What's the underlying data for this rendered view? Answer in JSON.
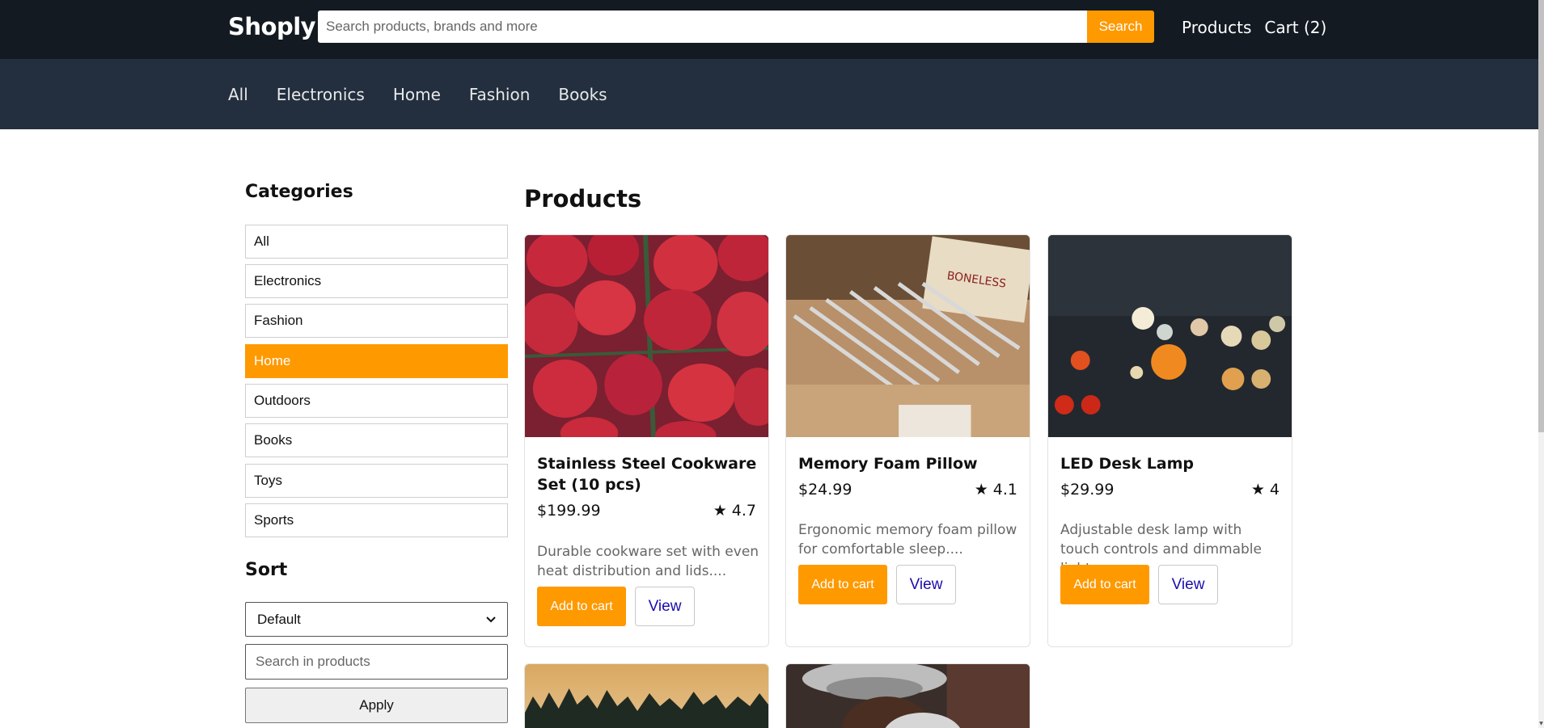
{
  "header": {
    "logo": "Shoply",
    "search_placeholder": "Search products, brands and more",
    "search_button": "Search",
    "links": [
      "Products",
      "Cart (2)"
    ]
  },
  "nav": {
    "links": [
      "All",
      "Electronics",
      "Home",
      "Fashion",
      "Books"
    ]
  },
  "sidebar": {
    "categories_title": "Categories",
    "categories": [
      {
        "label": "All",
        "active": false
      },
      {
        "label": "Electronics",
        "active": false
      },
      {
        "label": "Fashion",
        "active": false
      },
      {
        "label": "Home",
        "active": true
      },
      {
        "label": "Outdoors",
        "active": false
      },
      {
        "label": "Books",
        "active": false
      },
      {
        "label": "Toys",
        "active": false
      },
      {
        "label": "Sports",
        "active": false
      }
    ],
    "sort_title": "Sort",
    "sort_selected": "Default",
    "search_placeholder": "Search in products",
    "apply_label": "Apply"
  },
  "main": {
    "title": "Products",
    "products": [
      {
        "name": "Stainless Steel Cookware Set (10 pcs)",
        "price": "$199.99",
        "rating": "★ 4.7",
        "description": "Durable cookware set with even heat distribution and lids....",
        "add_label": "Add to cart",
        "view_label": "View",
        "image": "strawberries-photo"
      },
      {
        "name": "Memory Foam Pillow",
        "price": "$24.99",
        "rating": "★ 4.1",
        "description": "Ergonomic memory foam pillow for comfortable sleep....",
        "add_label": "Add to cart",
        "view_label": "View",
        "image": "rulers-photo"
      },
      {
        "name": "LED Desk Lamp",
        "price": "$29.99",
        "rating": "★ 4",
        "description": "Adjustable desk lamp with touch controls and dimmable light....",
        "add_label": "Add to cart",
        "view_label": "View",
        "image": "bokeh-lights-photo"
      },
      {
        "name": "",
        "image": "forest-sunset-photo"
      },
      {
        "name": "",
        "image": "person-hat-photo"
      }
    ]
  },
  "colors": {
    "header_bg": "#131a22",
    "nav_bg": "#232f3e",
    "accent": "#ff9900",
    "link_blue": "#1a0dab"
  }
}
